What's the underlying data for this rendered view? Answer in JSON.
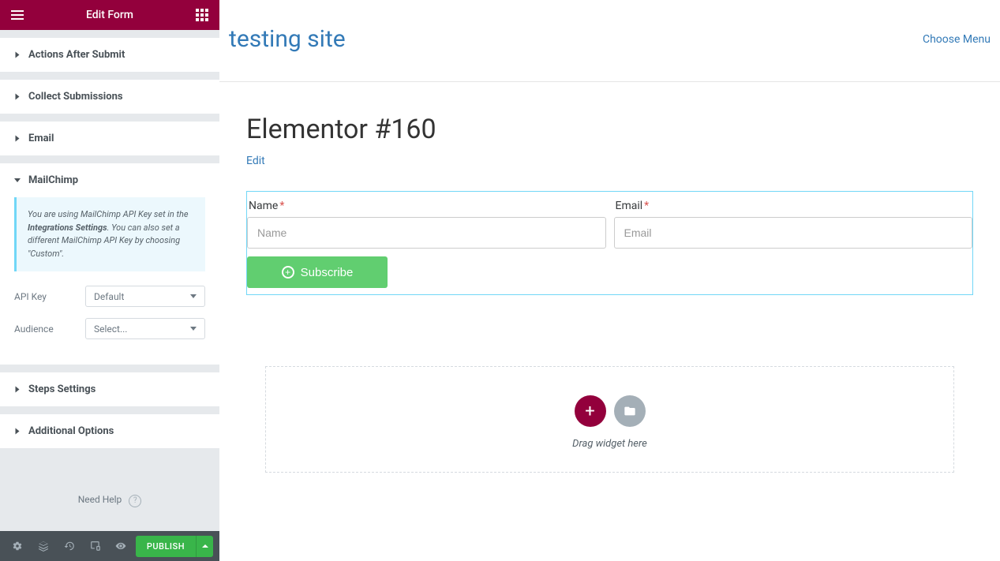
{
  "sidebar": {
    "title": "Edit Form",
    "panels": {
      "actions": "Actions After Submit",
      "collect": "Collect Submissions",
      "email": "Email",
      "mailchimp": "MailChimp",
      "steps": "Steps Settings",
      "additional": "Additional Options"
    },
    "mailchimp": {
      "info_pre": "You are using MailChimp API Key set in the ",
      "info_bold": "Integrations Settings",
      "info_post": ". You can also set a different MailChimp API Key by choosing \"Custom\".",
      "api_key_label": "API Key",
      "api_key_value": "Default",
      "audience_label": "Audience",
      "audience_value": "Select..."
    },
    "help": "Need Help"
  },
  "footer": {
    "publish": "PUBLISH"
  },
  "canvas": {
    "site_title": "testing site",
    "choose_menu": "Choose Menu",
    "page_title": "Elementor #160",
    "edit": "Edit",
    "form": {
      "name_label": "Name",
      "name_placeholder": "Name",
      "email_label": "Email",
      "email_placeholder": "Email",
      "subscribe": "Subscribe"
    },
    "drop": "Drag widget here"
  }
}
